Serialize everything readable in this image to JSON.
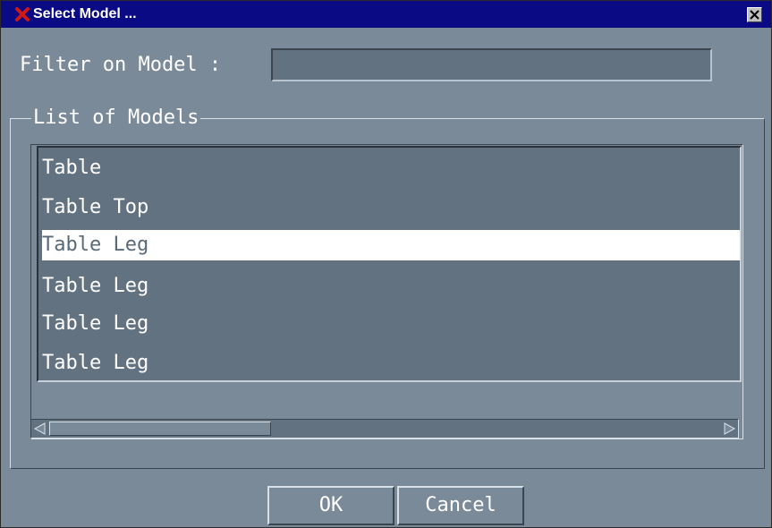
{
  "window": {
    "title": "Select Model ..."
  },
  "filter": {
    "label": "Filter on Model :",
    "value": ""
  },
  "models_group": {
    "legend": "List of Models",
    "items": [
      {
        "label": "Table",
        "selected": false
      },
      {
        "label": "Table Top",
        "selected": false
      },
      {
        "label": "Table Leg",
        "selected": true
      },
      {
        "label": "Table Leg",
        "selected": false
      },
      {
        "label": "Table Leg",
        "selected": false
      },
      {
        "label": "Table Leg",
        "selected": false
      }
    ],
    "horizontal_scroll_position": 0
  },
  "buttons": {
    "ok": "OK",
    "cancel": "Cancel"
  },
  "colors": {
    "titlebar": "#0a0a84",
    "window_bg": "#7a8a99",
    "list_bg": "#637280",
    "selection_bg": "#ffffff",
    "app_icon": "#d01818"
  }
}
